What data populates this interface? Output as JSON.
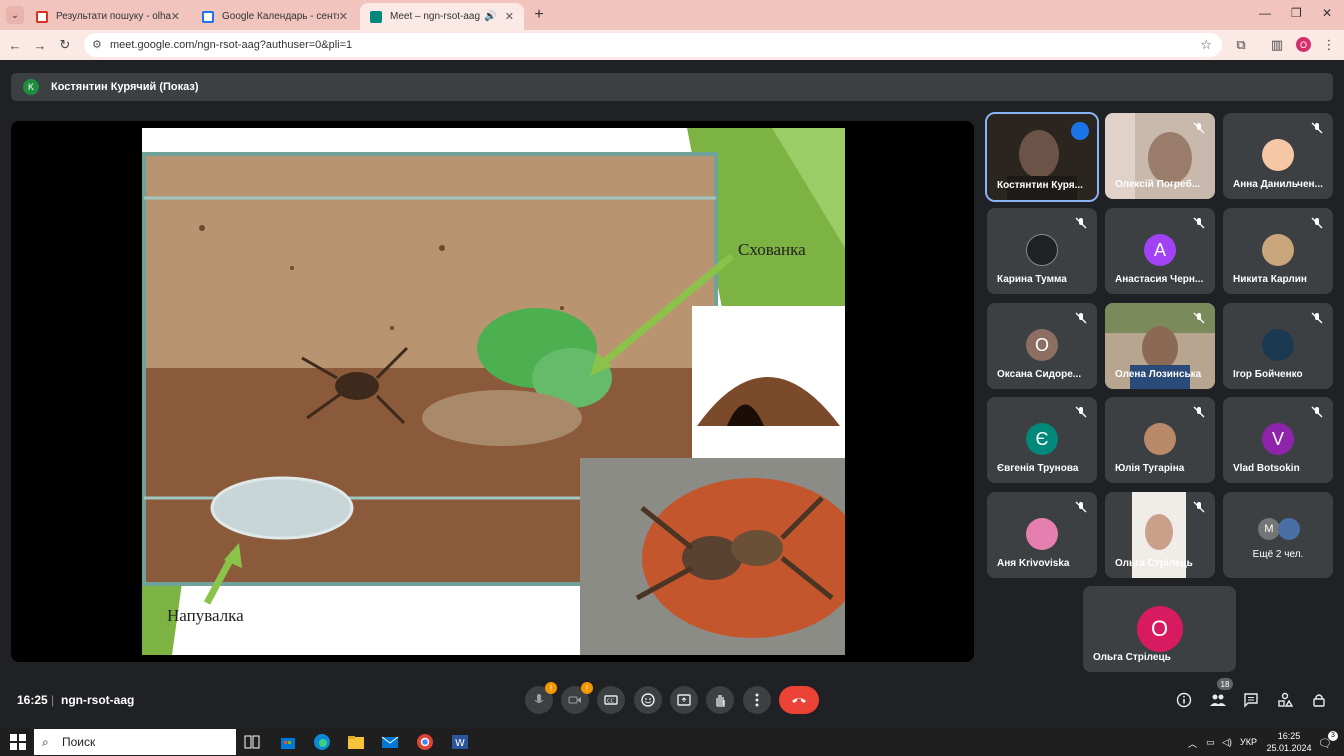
{
  "browser": {
    "tabs": [
      {
        "title": "Результати пошуку - olhastrile",
        "favicon": "gmail-icon",
        "color": "#d93025"
      },
      {
        "title": "Google Календарь - сентябрь",
        "favicon": "calendar-icon",
        "color": "#1a73e8"
      },
      {
        "title": "Meet – ngn-rsot-aag",
        "favicon": "meet-icon",
        "color": "#00897b"
      }
    ],
    "url": "meet.google.com/ngn-rsot-aag?authuser=0&pli=1",
    "profile_initial": "O"
  },
  "presenter": {
    "initial": "K",
    "label": "Костянтин Курячий (Показ)"
  },
  "slide": {
    "label_hide": "Схованка",
    "label_water": "Напувалка"
  },
  "participants": [
    {
      "name": "Костянтин Куря...",
      "initial": "",
      "color": "#5f6368",
      "photo": true
    },
    {
      "name": "Олексій Погреб...",
      "initial": "",
      "color": "#5f6368",
      "photo": true
    },
    {
      "name": "Анна Данильчен...",
      "initial": "",
      "color": "#f6c7a4",
      "photo": false
    },
    {
      "name": "Карина Тумма",
      "initial": "",
      "color": "#202124",
      "photo": false
    },
    {
      "name": "Анастасия Черн...",
      "initial": "A",
      "color": "#a142f4",
      "photo": false
    },
    {
      "name": "Никита Карлин",
      "initial": "",
      "color": "#c9a57b",
      "photo": false
    },
    {
      "name": "Оксана Сидоре...",
      "initial": "О",
      "color": "#8d6e63",
      "photo": false
    },
    {
      "name": "Олена Лозинська",
      "initial": "",
      "color": "#5f6368",
      "photo": true
    },
    {
      "name": "Ігор Бойченко",
      "initial": "",
      "color": "#1b3a52",
      "photo": false
    },
    {
      "name": "Євгенія Трунова",
      "initial": "Є",
      "color": "#00897b",
      "photo": false
    },
    {
      "name": "Юлія Тугаріна",
      "initial": "",
      "color": "#b98a6a",
      "photo": false
    },
    {
      "name": "Vlad Botsokin",
      "initial": "V",
      "color": "#8e24aa",
      "photo": false
    },
    {
      "name": "Аня Krivoviska",
      "initial": "",
      "color": "#e57fb0",
      "photo": false
    },
    {
      "name": "Ольга Стрілець",
      "initial": "",
      "color": "#5f6368",
      "photo": true
    },
    {
      "name": "Ещё 2 чел.",
      "initial": "M",
      "color": "#757575",
      "photo": false
    },
    {
      "name": "Ольга Стрілець",
      "initial": "O",
      "color": "#d81b60",
      "photo": false
    }
  ],
  "more_second_initial": "",
  "bottom": {
    "time": "16:25",
    "separator": "|",
    "meeting_code": "ngn-rsot-aag",
    "mic_badge": "!",
    "cam_badge": "!",
    "people_count": "18"
  },
  "taskbar": {
    "search_placeholder": "Поиск",
    "lang": "УКР",
    "time": "16:25",
    "date": "25.01.2024",
    "notif_count": "3"
  }
}
